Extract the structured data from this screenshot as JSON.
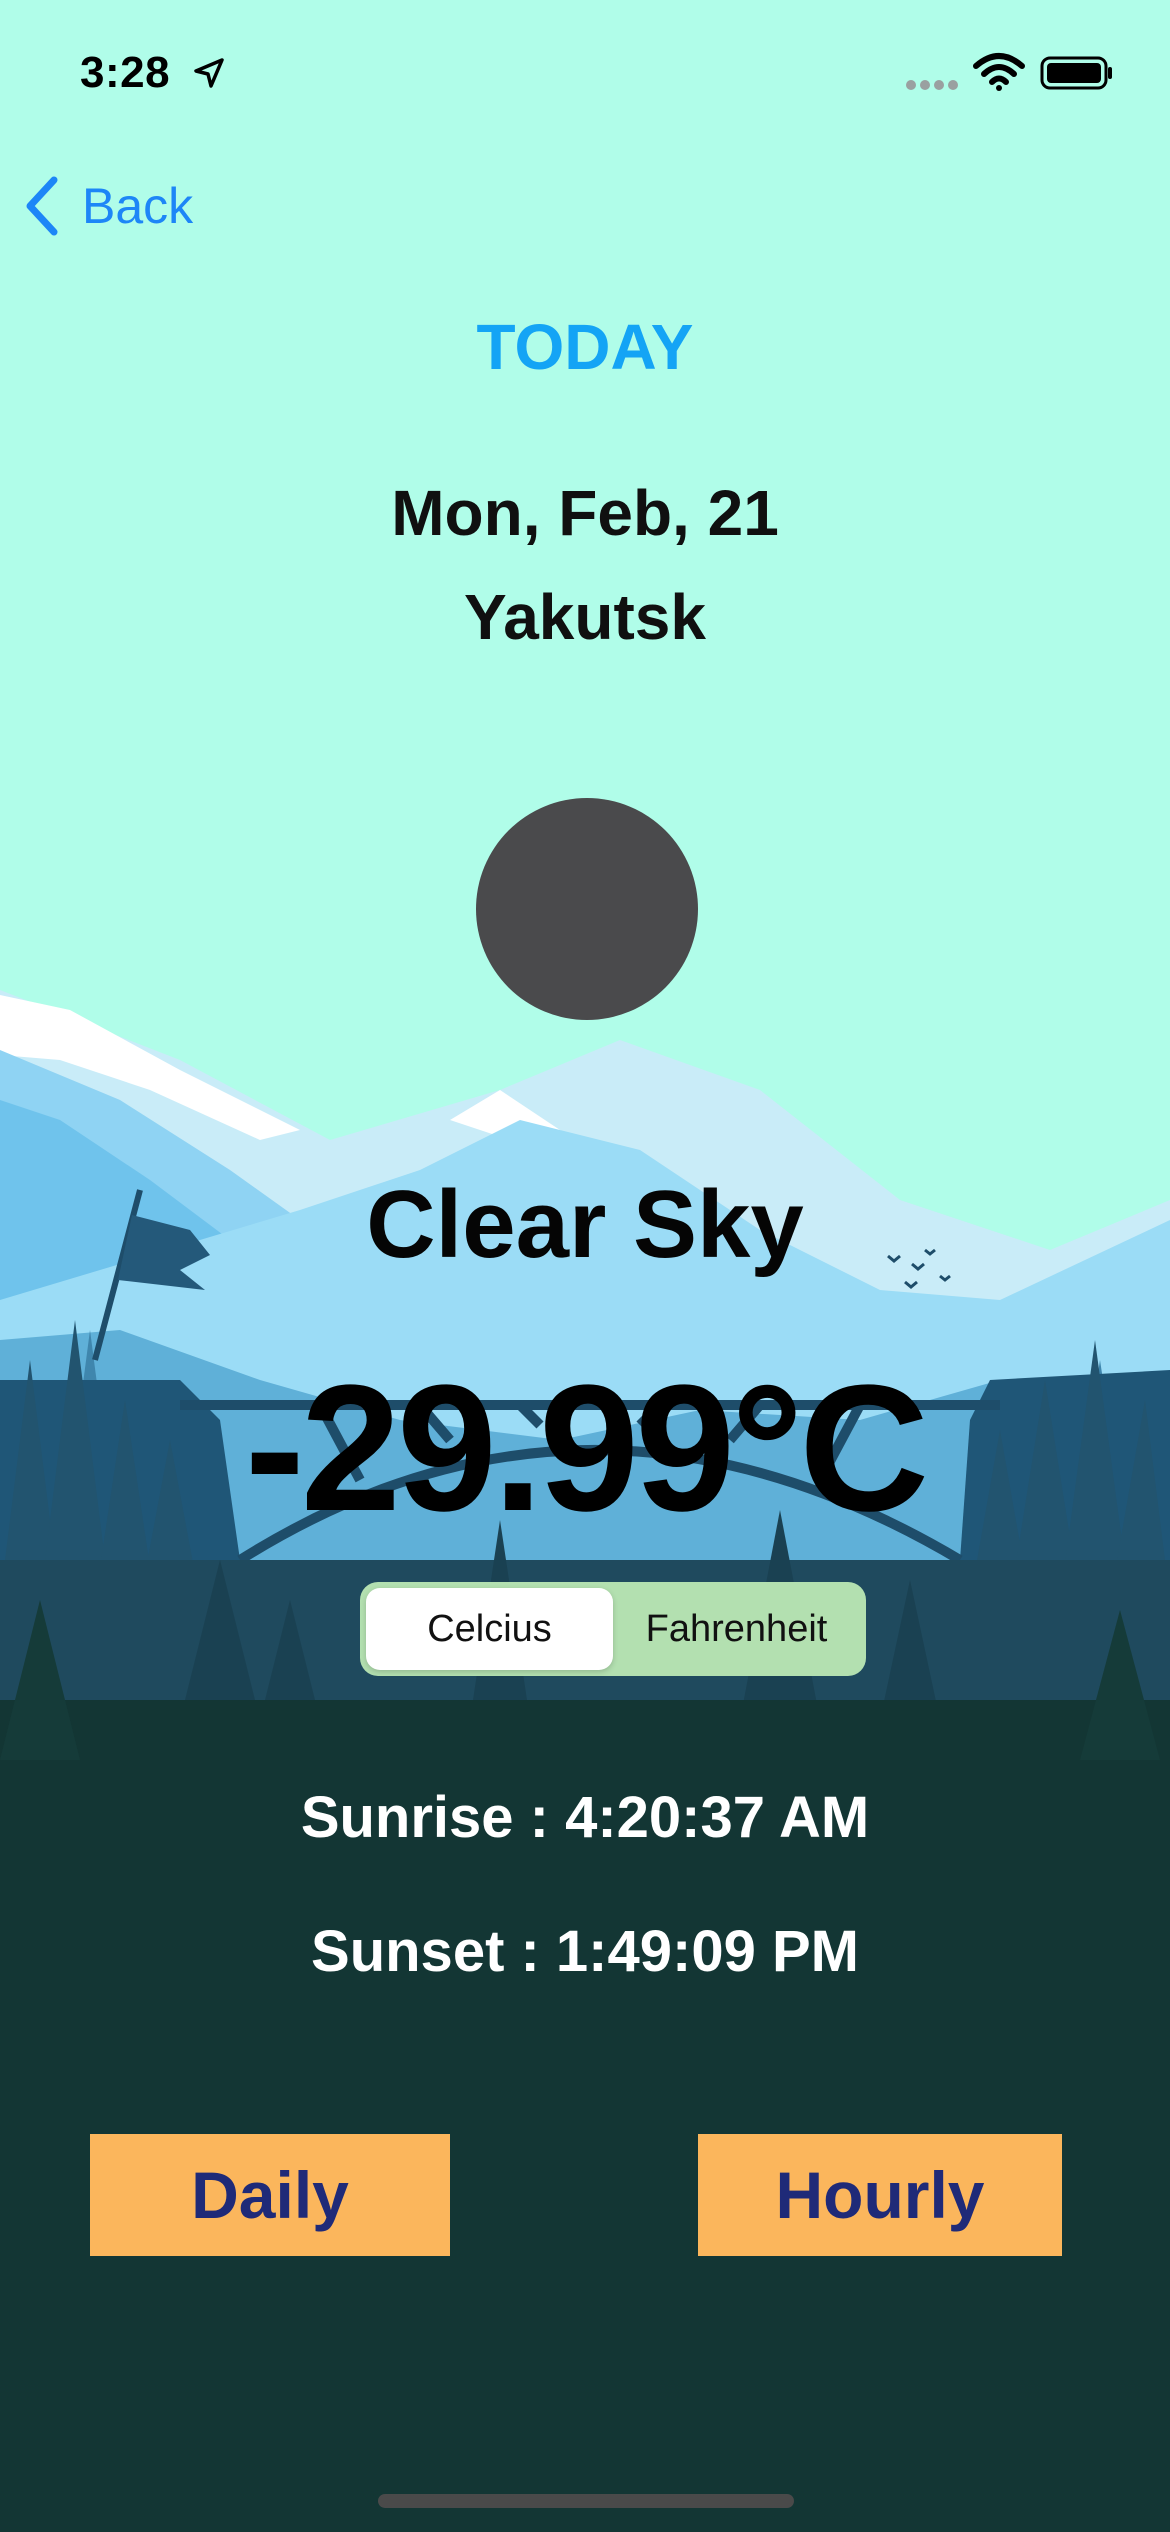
{
  "status_bar": {
    "time": "3:28",
    "icons": [
      "location-arrow-icon",
      "cellular-signal-icon",
      "wifi-icon",
      "battery-icon"
    ]
  },
  "nav": {
    "back_label": "Back",
    "back_icon": "chevron-left-icon"
  },
  "header": {
    "title": "TODAY",
    "date": "Mon, Feb, 21",
    "city": "Yakutsk"
  },
  "weather": {
    "icon": "weather-condition-icon",
    "condition": "Clear Sky",
    "temperature": "-29.99°C"
  },
  "unit_toggle": {
    "options": [
      "Celcius",
      "Fahrenheit"
    ],
    "selected": "Celcius"
  },
  "sun_times": {
    "sunrise": "Sunrise : 4:20:37 AM",
    "sunset": "Sunset : 1:49:09 PM"
  },
  "actions": {
    "daily_label": "Daily",
    "hourly_label": "Hourly"
  },
  "colors": {
    "sky": "#b0fde9",
    "accent_blue": "#14a4f5",
    "back_blue": "#1d86f7",
    "button_orange": "#fbb65c",
    "button_text": "#1f2a78",
    "forest_dark": "#133634"
  }
}
